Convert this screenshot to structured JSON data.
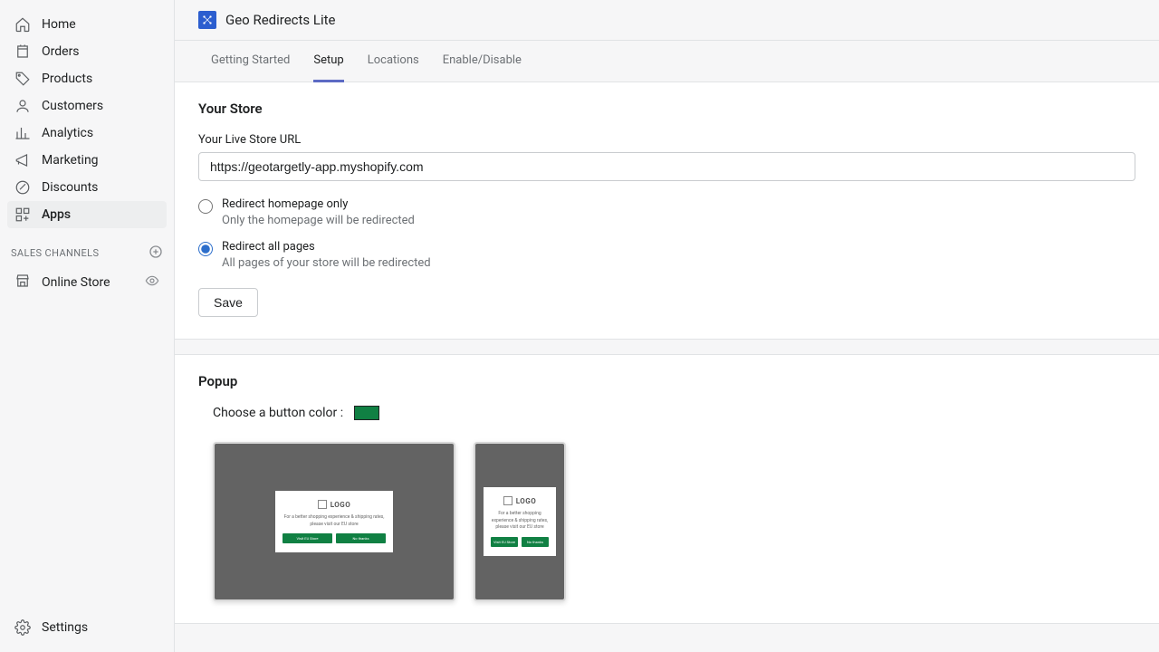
{
  "sidebar": {
    "items": [
      {
        "label": "Home"
      },
      {
        "label": "Orders"
      },
      {
        "label": "Products"
      },
      {
        "label": "Customers"
      },
      {
        "label": "Analytics"
      },
      {
        "label": "Marketing"
      },
      {
        "label": "Discounts"
      },
      {
        "label": "Apps"
      }
    ],
    "channels_header": "SALES CHANNELS",
    "channels": [
      {
        "label": "Online Store"
      }
    ],
    "settings": "Settings"
  },
  "app": {
    "title": "Geo Redirects Lite"
  },
  "tabs": [
    {
      "label": "Getting Started"
    },
    {
      "label": "Setup"
    },
    {
      "label": "Locations"
    },
    {
      "label": "Enable/Disable"
    }
  ],
  "store_section": {
    "title": "Your Store",
    "url_label": "Your Live Store URL",
    "url_value": "https://geotargetly-app.myshopify.com",
    "options": [
      {
        "title": "Redirect homepage only",
        "desc": "Only the homepage will be redirected"
      },
      {
        "title": "Redirect all pages",
        "desc": "All pages of your store will be redirected"
      }
    ],
    "save_label": "Save"
  },
  "popup_section": {
    "title": "Popup",
    "color_label": "Choose a button color :",
    "button_color": "#108043",
    "preview": {
      "logo_text": "LOGO",
      "body_text": "For a better shopping experience & shipping rates, please visit our EU store",
      "btn1": "Visit EU Store",
      "btn2": "No thanks"
    }
  }
}
